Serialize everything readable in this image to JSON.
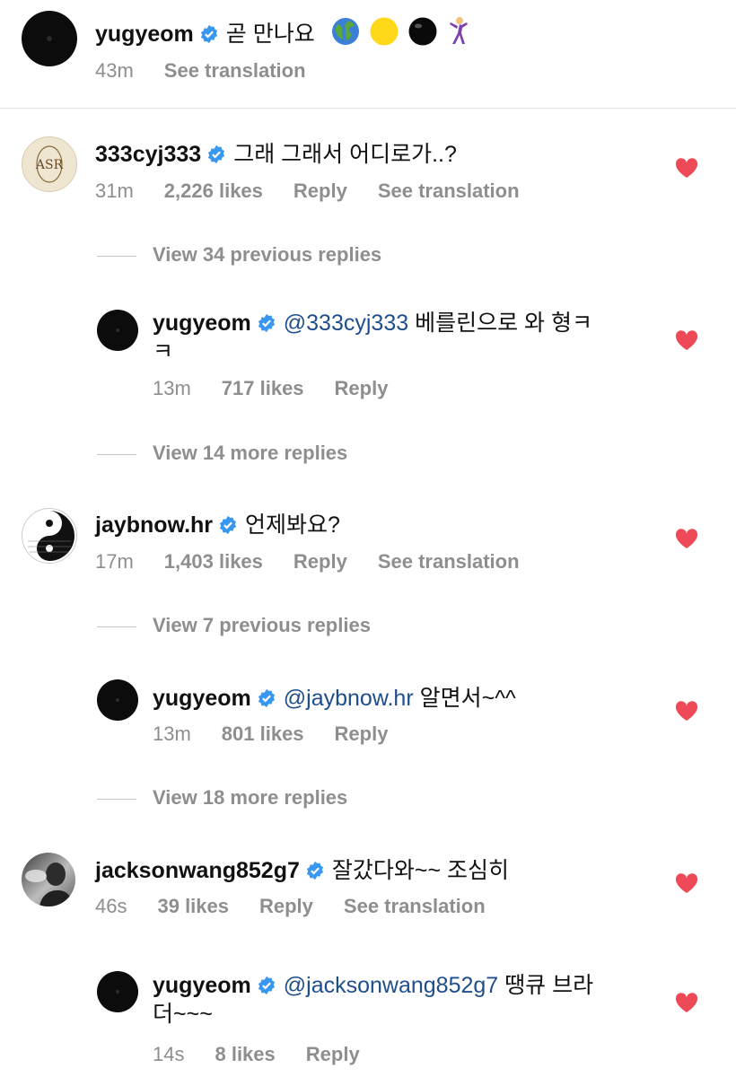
{
  "caption": {
    "username": "yugyeom",
    "text": "곧 만나요",
    "emojis": [
      "globe-icon",
      "yellow-circle-icon",
      "black-circle-icon",
      "dancer-icon"
    ],
    "time": "43m",
    "see_translation": "See translation"
  },
  "comments": [
    {
      "username": "333cyj333",
      "text": "그래 그래서 어디로가..?",
      "time": "31m",
      "likes": "2,226 likes",
      "reply": "Reply",
      "see_translation": "See translation",
      "view_previous": "View 34 previous replies",
      "reply_comment": {
        "username": "yugyeom",
        "mention": "@333cyj333",
        "text": "베를린으로 와 형ㅋ",
        "text_line2": "ㅋ",
        "time": "13m",
        "likes": "717 likes",
        "reply": "Reply"
      },
      "view_more": "View 14 more replies"
    },
    {
      "username": "jaybnow.hr",
      "text": "언제봐요?",
      "time": "17m",
      "likes": "1,403 likes",
      "reply": "Reply",
      "see_translation": "See translation",
      "view_previous": "View 7 previous replies",
      "reply_comment": {
        "username": "yugyeom",
        "mention": "@jaybnow.hr",
        "text": "알면서~^^",
        "time": "13m",
        "likes": "801 likes",
        "reply": "Reply"
      },
      "view_more": "View 18 more replies"
    },
    {
      "username": "jacksonwang852g7",
      "text": "잘갔다와~~ 조심히",
      "time": "46s",
      "likes": "39 likes",
      "reply": "Reply",
      "see_translation": "See translation",
      "reply_comment": {
        "username": "yugyeom",
        "mention": "@jacksonwang852g7",
        "text": "땡큐 브라",
        "text_line2": "더~~~",
        "time": "14s",
        "likes": "8 likes",
        "reply": "Reply"
      }
    }
  ],
  "colors": {
    "heart": "#ed4956",
    "verified": "#3897f0",
    "mention": "#1f4e8c",
    "meta": "#8e8e8e"
  }
}
